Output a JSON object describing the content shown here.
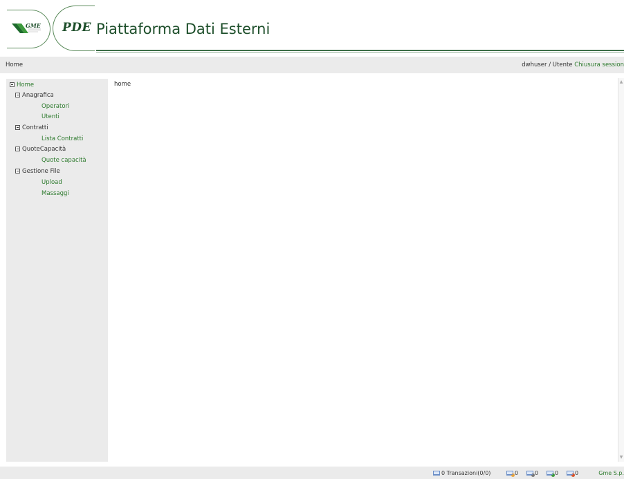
{
  "header": {
    "logo_gme": "GME",
    "logo_pde": "PDE",
    "title": "Piattaforma Dati Esterni"
  },
  "topbar": {
    "breadcrumb": "Home",
    "user": "dwhuser",
    "separator": " / ",
    "role": "Utente",
    "logout": "Chiusura session"
  },
  "sidebar": {
    "home": "Home",
    "sections": [
      {
        "label": "Anagrafica",
        "items": [
          "Operatori",
          "Utenti"
        ]
      },
      {
        "label": "Contratti",
        "items": [
          "Lista Contratti"
        ]
      },
      {
        "label": "QuoteCapacità",
        "items": [
          "Quote capacità"
        ]
      },
      {
        "label": "Gestione File",
        "items": [
          "Upload",
          "Massaggi"
        ]
      }
    ]
  },
  "main": {
    "content": "home"
  },
  "statusbar": {
    "messages_count": "0",
    "transactions": "Transazioni(0/0)",
    "counter_1": "0",
    "counter_2": "0",
    "counter_3": "0",
    "counter_4": "0",
    "copyright": "Gme S.p."
  },
  "colors": {
    "brand_green": "#1e4f2b",
    "link_green": "#2d7a2d",
    "bar_grey": "#ebebeb"
  }
}
